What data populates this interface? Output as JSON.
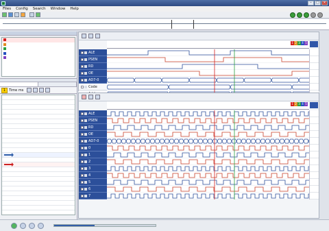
{
  "window": {
    "title": ""
  },
  "menu": [
    "Files",
    "Config",
    "Search",
    "Window",
    "Help"
  ],
  "toolbar": {
    "fetch_label": "",
    "status": ""
  },
  "left": {
    "panel_title": "",
    "markers": [
      {
        "label": "",
        "color": "#d42020",
        "selected": true
      },
      {
        "label": "",
        "color": "#e08a20",
        "selected": false
      },
      {
        "label": "",
        "color": "#2aa040",
        "selected": false
      },
      {
        "label": "",
        "color": "#2450c0",
        "selected": false
      },
      {
        "label": "",
        "color": "#8040c0",
        "selected": false
      }
    ],
    "decoded_tabs_line": "",
    "subtabs": [
      "",
      ""
    ],
    "list_tools": {
      "badge": "1",
      "label": "Time ms"
    },
    "table_rows": [
      {
        "t": "",
        "v": ""
      },
      {
        "t": "",
        "v": ""
      },
      {
        "t": "",
        "v": ""
      },
      {
        "t": "",
        "v": ""
      },
      {
        "t": "",
        "v": ""
      },
      {
        "t": "",
        "v": ""
      },
      {
        "t": "",
        "v": ""
      },
      {
        "t": "",
        "v": ""
      },
      {
        "t": "",
        "v": ""
      },
      {
        "t": "",
        "v": ""
      },
      {
        "t": "",
        "v": ""
      },
      {
        "t": "",
        "v": ""
      },
      {
        "t": "",
        "v": ""
      },
      {
        "t": "",
        "v": ""
      },
      {
        "t": "",
        "v": ""
      },
      {
        "t": "",
        "v": ""
      },
      {
        "t": "",
        "v": ""
      },
      {
        "t": "",
        "v": ""
      },
      {
        "t": "",
        "v": ""
      },
      {
        "t": "",
        "v": ""
      },
      {
        "t": "",
        "v": ""
      },
      {
        "t": "",
        "v": ""
      },
      {
        "t": "",
        "v": ""
      },
      {
        "t": "",
        "v": ""
      }
    ]
  },
  "pane1": {
    "timebar_label": "",
    "signals": [
      {
        "name": "ALE",
        "type": "signal",
        "value": ""
      },
      {
        "name": "PSEN",
        "type": "signal",
        "value": ""
      },
      {
        "name": "RD",
        "type": "signal",
        "value": ""
      },
      {
        "name": "OE",
        "type": "signal",
        "value": ""
      },
      {
        "name": "AD7-0",
        "type": "signal",
        "value": ""
      },
      {
        "name": "Code",
        "type": "group",
        "value": ""
      },
      {
        "name": "Address",
        "type": "group",
        "value": ""
      }
    ]
  },
  "pane2": {
    "timebar_label": "",
    "signals": [
      {
        "name": "ALE",
        "type": "signal",
        "value": ""
      },
      {
        "name": "PSEN",
        "type": "signal",
        "value": ""
      },
      {
        "name": "RD",
        "type": "signal",
        "value": ""
      },
      {
        "name": "OE",
        "type": "signal",
        "value": ""
      },
      {
        "name": "AD7-0",
        "type": "signal",
        "value": ""
      },
      {
        "name": "0",
        "type": "signal",
        "value": ""
      },
      {
        "name": "1",
        "type": "signal",
        "value": ""
      },
      {
        "name": "2",
        "type": "signal",
        "value": ""
      },
      {
        "name": "3",
        "type": "signal",
        "value": ""
      },
      {
        "name": "4",
        "type": "signal",
        "value": ""
      },
      {
        "name": "5",
        "type": "signal",
        "value": ""
      },
      {
        "name": "6",
        "type": "signal",
        "value": ""
      },
      {
        "name": "7",
        "type": "signal",
        "value": ""
      }
    ]
  },
  "colorbar": [
    {
      "label": "1",
      "color": "#d42020"
    },
    {
      "label": "2",
      "color": "#e08a20"
    },
    {
      "label": "3",
      "color": "#2aa040"
    },
    {
      "label": "4",
      "color": "#2450c0"
    },
    {
      "label": "5",
      "color": "#8040c0"
    }
  ],
  "statusbar": {
    "config": "",
    "info": ""
  },
  "accent": "#2c4f9a"
}
